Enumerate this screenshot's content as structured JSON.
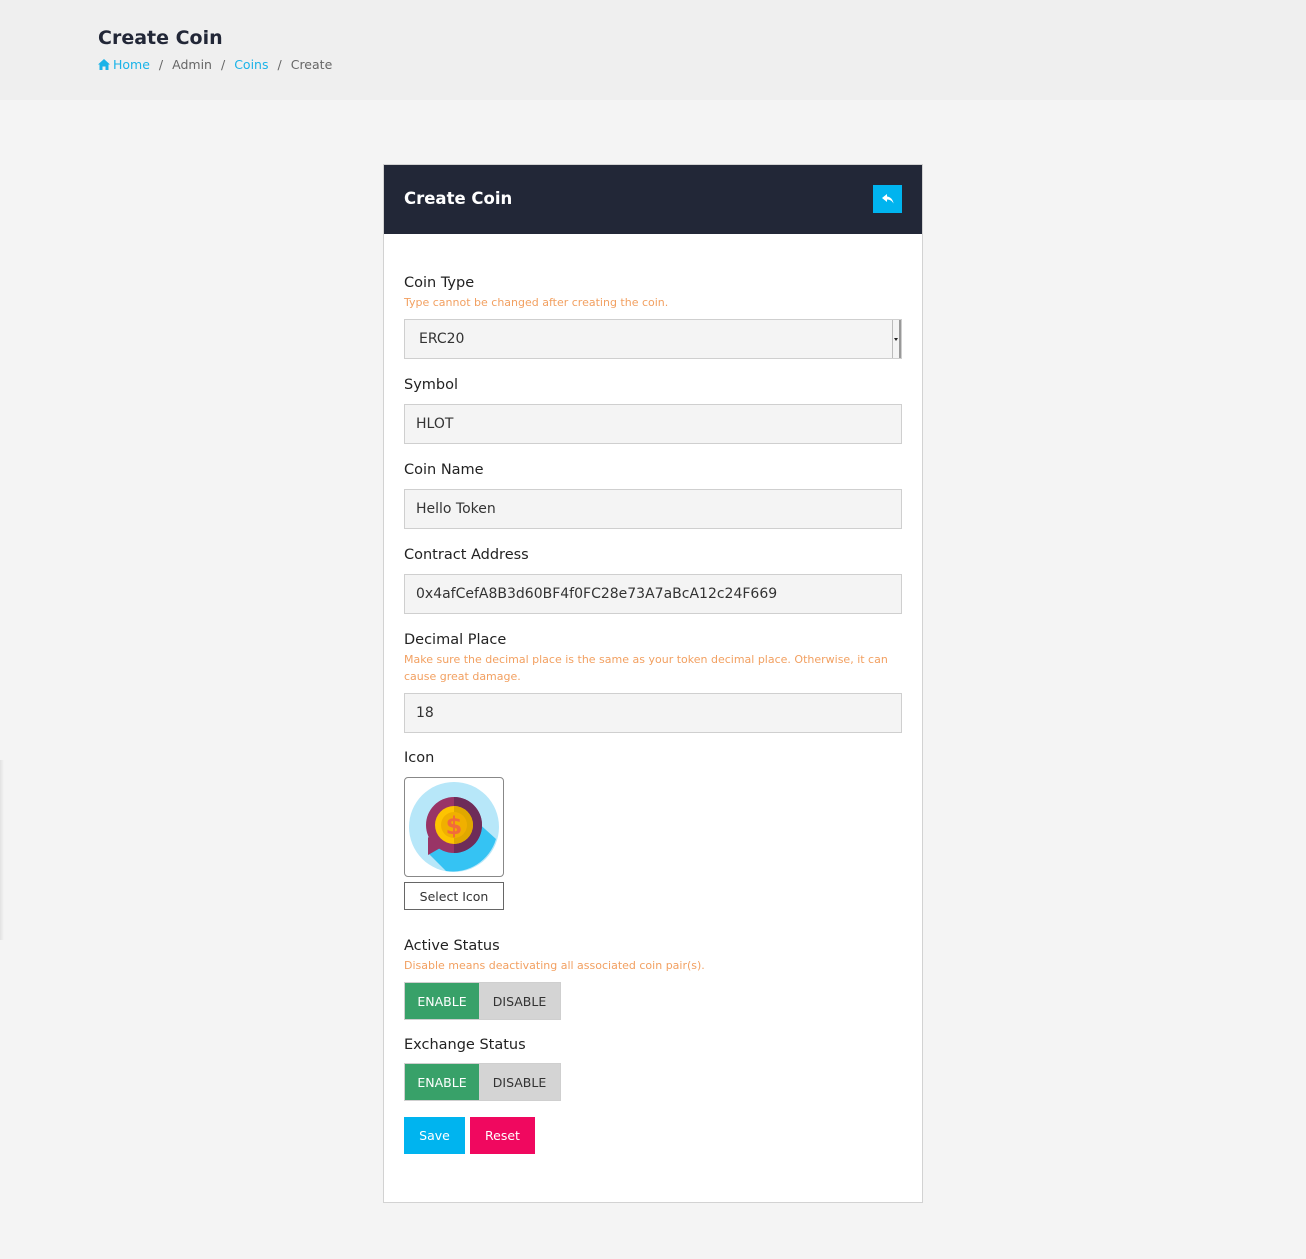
{
  "header": {
    "title": "Create Coin",
    "breadcrumb": [
      {
        "label": "Home",
        "icon": "home-icon",
        "link": true
      },
      {
        "label": "Admin",
        "link": false
      },
      {
        "label": "Coins",
        "link": true
      },
      {
        "label": "Create",
        "link": false
      }
    ],
    "separator": "/"
  },
  "card": {
    "title": "Create Coin",
    "back_icon": "reply-arrow-icon"
  },
  "form": {
    "coin_type": {
      "label": "Coin Type",
      "hint": "Type cannot be changed after creating the coin.",
      "value": "ERC20"
    },
    "symbol": {
      "label": "Symbol",
      "value": "HLOT"
    },
    "coin_name": {
      "label": "Coin Name",
      "value": "Hello Token"
    },
    "contract_address": {
      "label": "Contract Address",
      "value": "0x4afCefA8B3d60BF4f0FC28e73A7aBcA12c24F669"
    },
    "decimal_place": {
      "label": "Decimal Place",
      "hint": "Make sure the decimal place is the same as your token decimal place. Otherwise, it can cause great damage.",
      "value": "18"
    },
    "icon": {
      "label": "Icon",
      "image": "coin-dollar-chat-icon",
      "select_label": "Select Icon"
    },
    "active_status": {
      "label": "Active Status",
      "hint": "Disable means deactivating all associated coin pair(s).",
      "enable_label": "ENABLE",
      "disable_label": "DISABLE",
      "selected": "ENABLE"
    },
    "exchange_status": {
      "label": "Exchange Status",
      "enable_label": "ENABLE",
      "disable_label": "DISABLE",
      "selected": "ENABLE"
    },
    "save_label": "Save",
    "reset_label": "Reset"
  },
  "colors": {
    "primary": "#00b4ef",
    "danger": "#f0085f",
    "success": "#38a169",
    "hint": "#f2a061",
    "card_header": "#222737"
  }
}
